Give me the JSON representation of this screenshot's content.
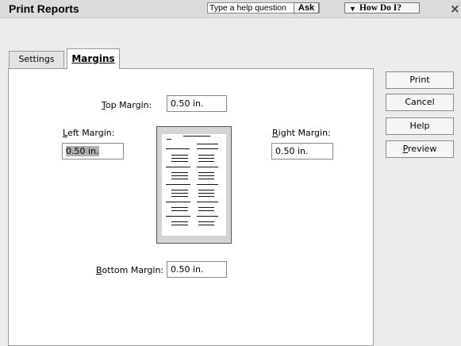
{
  "window": {
    "title": "Print Reports",
    "close_glyph": "×"
  },
  "help": {
    "placeholder": "Type a help question",
    "ask_label": "Ask",
    "how_do_i_label": "How Do I?"
  },
  "tabs": [
    {
      "label": "Settings",
      "active": false
    },
    {
      "label": "Margins",
      "active": true
    }
  ],
  "margins": {
    "top": {
      "mnemonic": "T",
      "label_rest": "op Margin:",
      "value": "0.50 in."
    },
    "left": {
      "mnemonic": "L",
      "label_rest": "eft Margin:",
      "value": "0.50 in."
    },
    "right": {
      "mnemonic": "R",
      "label_rest": "ight Margin:",
      "value": "0.50 in."
    },
    "bottom": {
      "mnemonic": "B",
      "label_rest": "ottom Margin:",
      "value": "0.50 in."
    }
  },
  "buttons": {
    "print": "Print",
    "cancel": "Cancel",
    "help": "Help",
    "preview": {
      "mnemonic": "P",
      "label_rest": "review"
    }
  }
}
